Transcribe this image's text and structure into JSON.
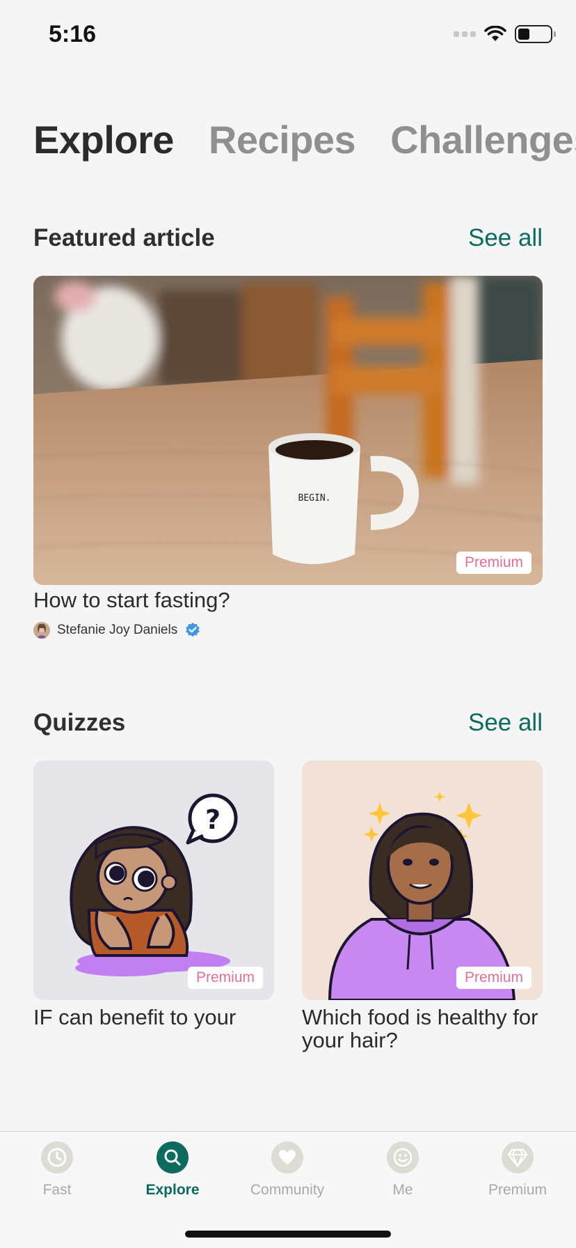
{
  "status": {
    "time": "5:16"
  },
  "top_tabs": [
    {
      "label": "Explore",
      "active": true
    },
    {
      "label": "Recipes",
      "active": false
    },
    {
      "label": "Challenges",
      "active": false
    }
  ],
  "featured": {
    "section_title": "Featured article",
    "see_all": "See all",
    "mug_text": "BEGIN.",
    "badge": "Premium",
    "title": "How to start fasting?",
    "author": "Stefanie Joy Daniels"
  },
  "quizzes": {
    "section_title": "Quizzes",
    "see_all": "See all",
    "items": [
      {
        "title": "IF can benefit to your",
        "badge": "Premium"
      },
      {
        "title": "Which food is healthy for your hair?",
        "badge": "Premium"
      }
    ]
  },
  "tab_bar": {
    "items": [
      {
        "label": "Fast",
        "icon": "clock-icon"
      },
      {
        "label": "Explore",
        "icon": "search-icon",
        "active": true
      },
      {
        "label": "Community",
        "icon": "heart-icon"
      },
      {
        "label": "Me",
        "icon": "smiley-icon"
      },
      {
        "label": "Premium",
        "icon": "diamond-icon"
      }
    ]
  },
  "colors": {
    "accent": "#0b6b5f",
    "premium_badge": "#e56f8f",
    "background": "#f5f5f5"
  }
}
